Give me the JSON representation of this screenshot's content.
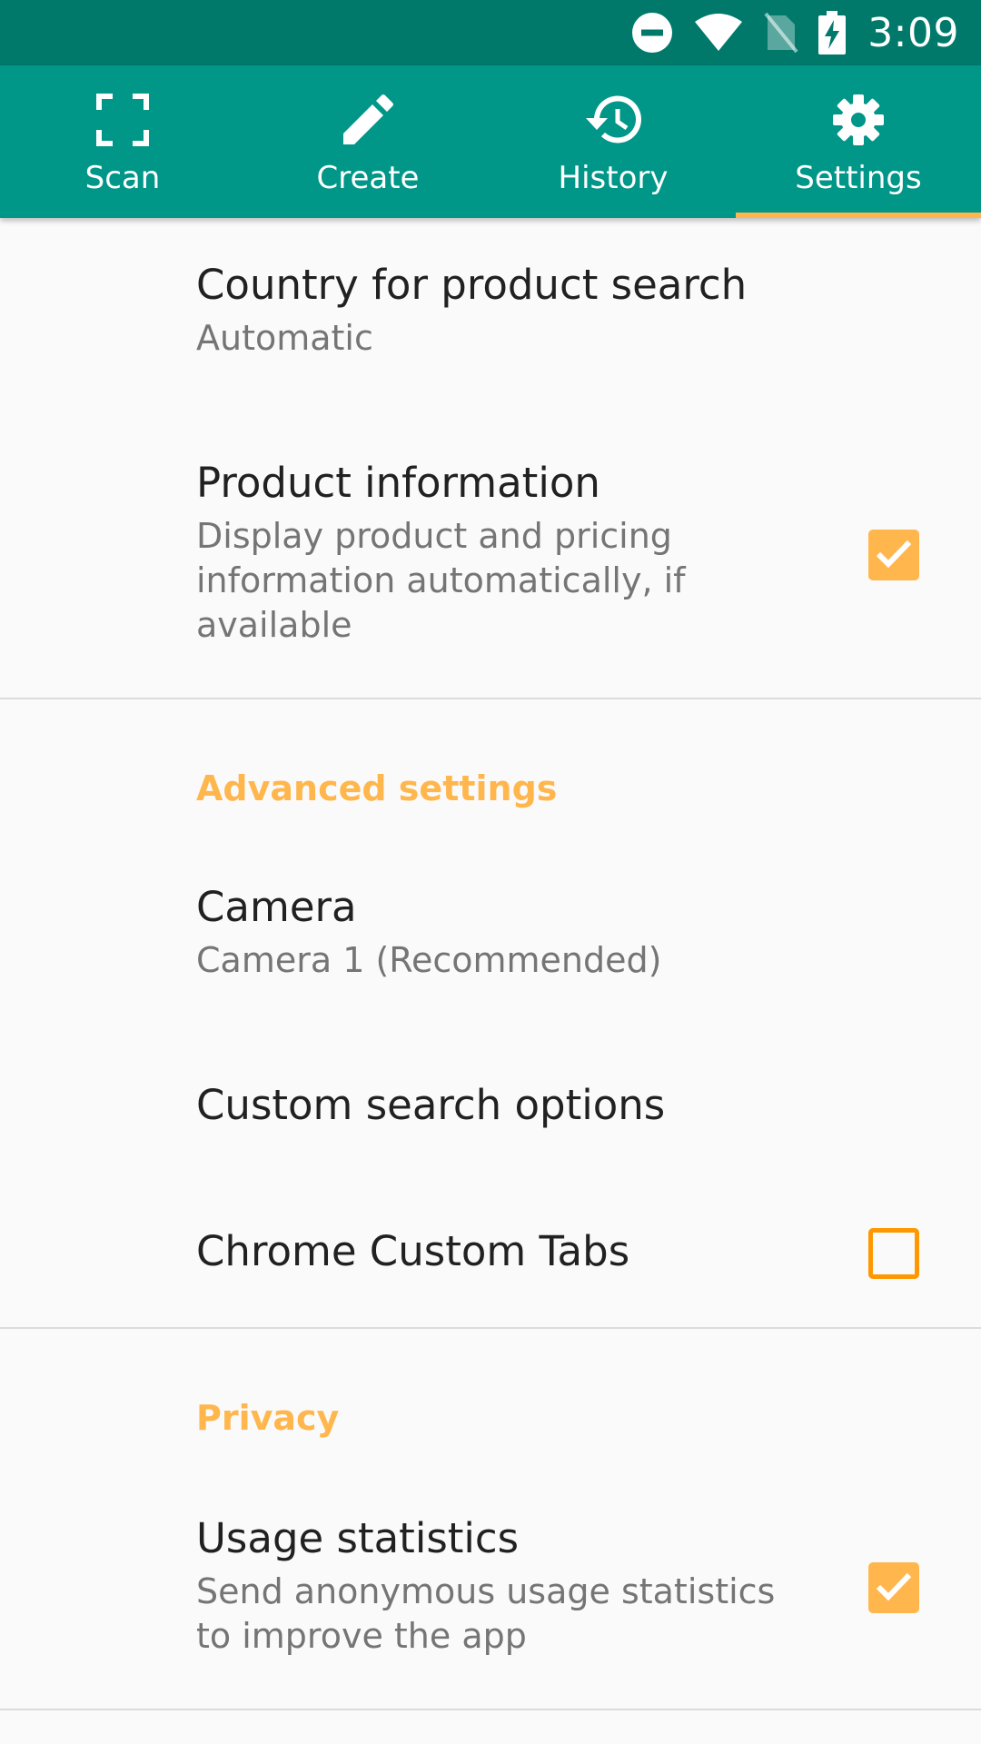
{
  "status_bar": {
    "time": "3:09",
    "icons": [
      "do-not-disturb-icon",
      "wifi-icon",
      "no-sim-icon",
      "battery-charging-icon"
    ]
  },
  "tabs": [
    {
      "label": "Scan",
      "icon": "scan-icon",
      "selected": false
    },
    {
      "label": "Create",
      "icon": "pencil-icon",
      "selected": false
    },
    {
      "label": "History",
      "icon": "history-icon",
      "selected": false
    },
    {
      "label": "Settings",
      "icon": "gear-icon",
      "selected": true
    }
  ],
  "settings": {
    "country": {
      "title": "Country for product search",
      "summary": "Automatic"
    },
    "product_info": {
      "title": "Product information",
      "summary": "Display product and pricing information automatically, if available",
      "checked": true
    },
    "advanced_header": "Advanced settings",
    "camera": {
      "title": "Camera",
      "summary": "Camera 1 (Recommended)"
    },
    "custom_search": {
      "title": "Custom search options"
    },
    "chrome_tabs": {
      "title": "Chrome Custom Tabs",
      "checked": false
    },
    "privacy_header": "Privacy",
    "usage_stats": {
      "title": "Usage statistics",
      "summary": "Send anonymous usage statistics to improve the app",
      "checked": true
    }
  },
  "colors": {
    "status_bar": "#00796b",
    "toolbar": "#009688",
    "accent": "#ffb74d",
    "checkbox_border": "#ff9800",
    "background": "#fafafa"
  }
}
